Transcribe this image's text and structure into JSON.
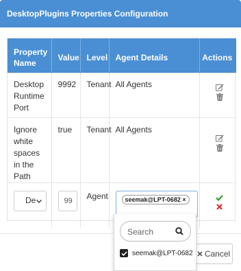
{
  "modal": {
    "title": "DesktopPlugins Properties Configuration"
  },
  "table": {
    "headers": [
      "Property Name",
      "Value",
      "Level",
      "Agent Details",
      "Actions"
    ],
    "rows": [
      {
        "property": "Desktop Runtime Port",
        "value": "9992",
        "level": "Tenant",
        "agent": "All Agents"
      },
      {
        "property": "Ignore white spaces in the Path",
        "value": "true",
        "level": "Tenant",
        "agent": "All Agents"
      }
    ],
    "edit_row": {
      "property_select": "De",
      "value_input": "99",
      "level": "Agent",
      "agent_chip": "seemak@LPT-0682 ×"
    }
  },
  "agent_dropdown": {
    "search_placeholder": "Search",
    "options": [
      {
        "label": "seemak@LPT-0682",
        "checked": true
      }
    ]
  },
  "footer": {
    "cancel_label": "Cancel"
  },
  "colors": {
    "header_blue": "#4a8fd3",
    "save_green": "#2e9a2e",
    "cancel_red": "#d9332b"
  }
}
